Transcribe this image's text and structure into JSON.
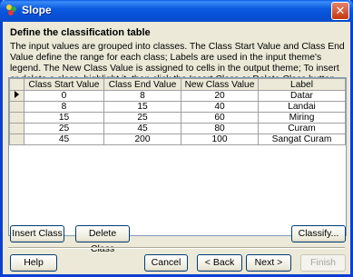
{
  "window": {
    "title": "Slope",
    "close_symbol": "✕"
  },
  "heading": "Define the classification table",
  "description": "The input values are grouped into classes. The Class Start Value and Class End Value define the range for each class; Labels are used in the input theme's legend. The New Class Value is assigned to cells in the output theme; To insert or delete a class, highlight it, then click the Insert Class or Delete Class button. To apply a classification method, click the Classify button.",
  "table": {
    "columns": [
      "Class Start Value",
      "Class End Value",
      "New Class Value",
      "Label"
    ],
    "rows": [
      [
        "0",
        "8",
        "20",
        "Datar"
      ],
      [
        "8",
        "15",
        "40",
        "Landai"
      ],
      [
        "15",
        "25",
        "60",
        "Miring"
      ],
      [
        "25",
        "45",
        "80",
        "Curam"
      ],
      [
        "45",
        "200",
        "100",
        "Sangat Curam"
      ]
    ]
  },
  "buttons": {
    "insert_class": "Insert Class",
    "delete_class": "Delete Class",
    "classify": "Classify...",
    "help": "Help",
    "cancel": "Cancel",
    "back": "< Back",
    "next": "Next >",
    "finish": "Finish"
  }
}
